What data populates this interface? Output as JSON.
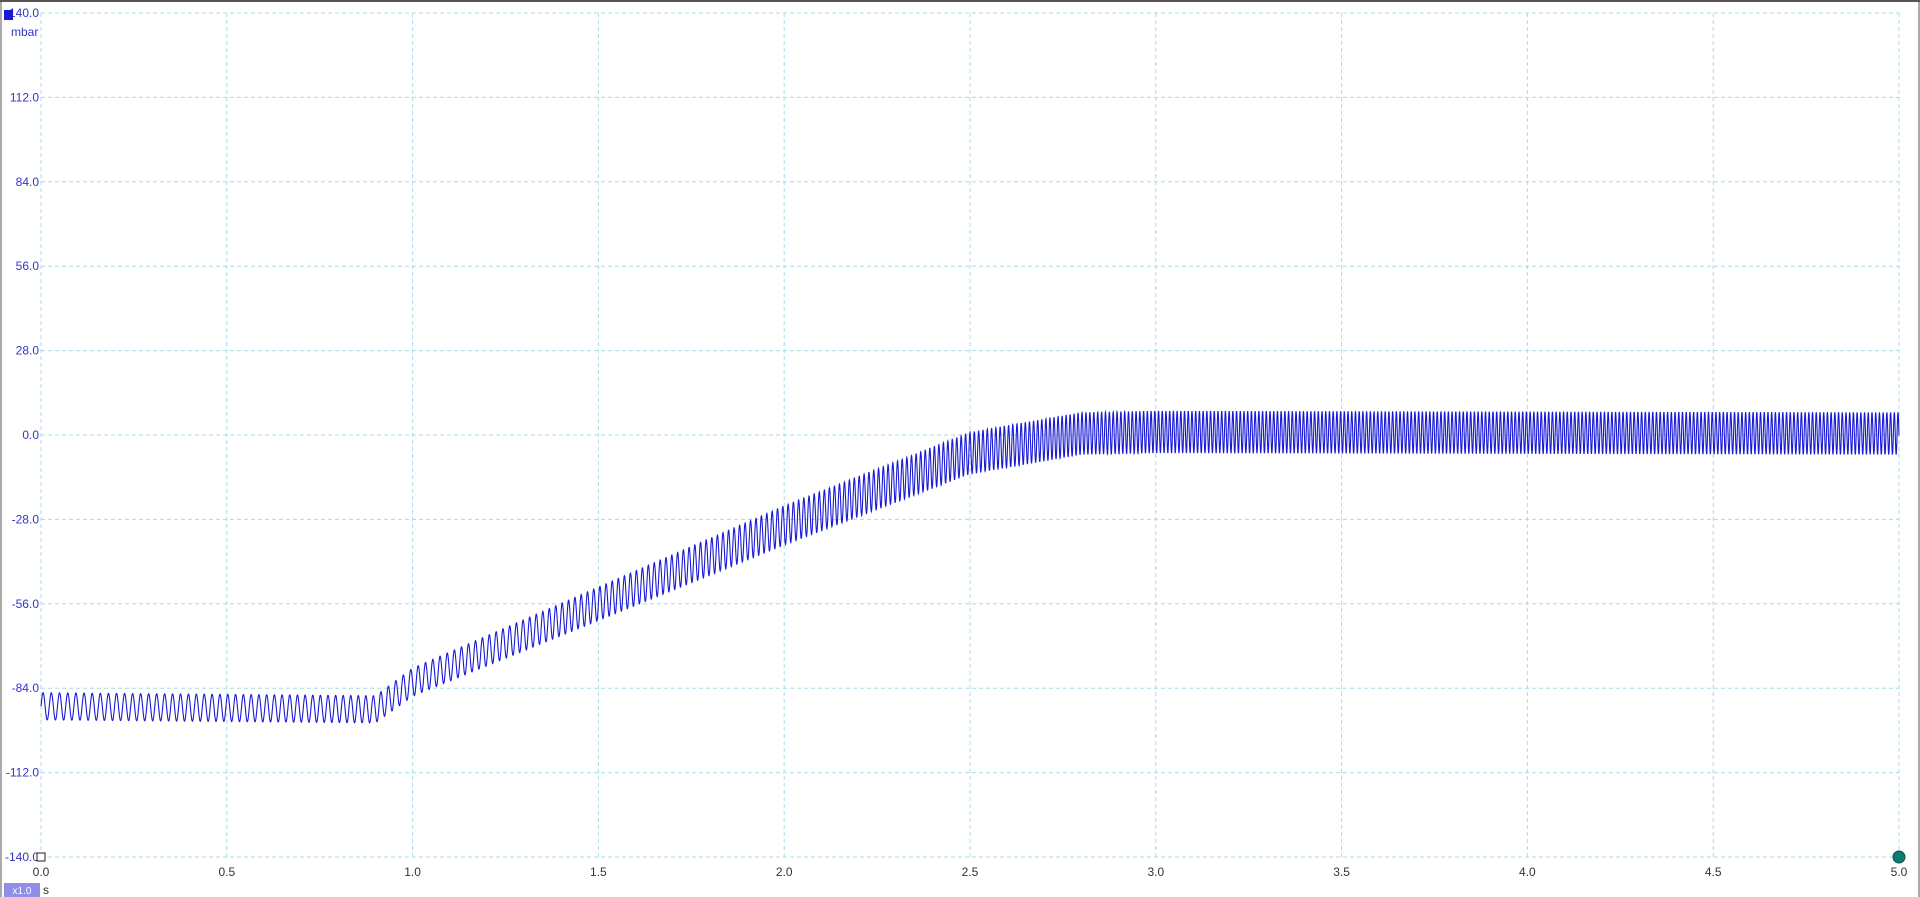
{
  "chart_data": {
    "type": "line",
    "y_unit": "mbar",
    "x_unit": "s",
    "zoom_label": "x1.0",
    "xlim": [
      0.0,
      5.0
    ],
    "ylim": [
      -140.0,
      140.0
    ],
    "x_ticks": [
      "0.0",
      "0.5",
      "1.0",
      "1.5",
      "2.0",
      "2.5",
      "3.0",
      "3.5",
      "4.0",
      "4.5",
      "5.0"
    ],
    "y_ticks": [
      "140.0",
      "112.0",
      "84.0",
      "56.0",
      "28.0",
      "0.0",
      "-28.0",
      "-56.0",
      "-84.0",
      "-112.0",
      "-140.0"
    ],
    "grid": true,
    "series": [
      {
        "color": "#1a1ad6",
        "baseline": [
          [
            0.0,
            -90.0
          ],
          [
            0.9,
            -91.0
          ],
          [
            1.0,
            -82.0
          ],
          [
            1.5,
            -56.0
          ],
          [
            2.0,
            -30.0
          ],
          [
            2.5,
            -6.0
          ],
          [
            2.8,
            0.5
          ],
          [
            3.0,
            1.0
          ],
          [
            5.0,
            0.5
          ]
        ],
        "oscillation": {
          "amplitude": [
            [
              0.0,
              4.5
            ],
            [
              0.9,
              4.5
            ],
            [
              1.2,
              5.0
            ],
            [
              2.0,
              6.5
            ],
            [
              2.6,
              7.0
            ],
            [
              3.0,
              7.0
            ],
            [
              5.0,
              7.0
            ]
          ],
          "frequency_hz": [
            [
              0.0,
              45.0
            ],
            [
              1.0,
              50.0
            ],
            [
              2.0,
              70.0
            ],
            [
              2.5,
              85.0
            ],
            [
              3.0,
              100.0
            ],
            [
              5.0,
              100.0
            ]
          ]
        }
      }
    ]
  },
  "colors": {
    "grid": "#a8dce8",
    "trace": "#1a1ad6",
    "axis_label": "#3333cc",
    "zoom_badge": "#8f8fe8",
    "marker": "#0f7a72"
  }
}
